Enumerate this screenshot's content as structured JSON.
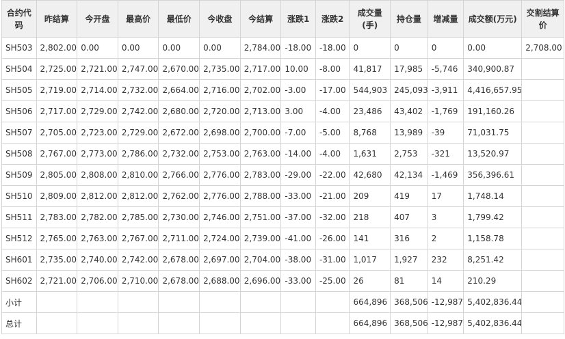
{
  "columns": [
    "合约代码",
    "昨结算",
    "今开盘",
    "最高价",
    "最低价",
    "今收盘",
    "今结算",
    "涨跌1",
    "涨跌2",
    "成交量(手)",
    "持仓量",
    "增减量",
    "成交额(万元)",
    "交割结算价"
  ],
  "rows": [
    [
      "SH503",
      "2,802.00",
      "0.00",
      "0.00",
      "0.00",
      "0.00",
      "2,784.00",
      "-18.00",
      "-18.00",
      "0",
      "0",
      "0",
      "0.00",
      "2,708.00"
    ],
    [
      "SH504",
      "2,725.00",
      "2,721.00",
      "2,747.00",
      "2,670.00",
      "2,735.00",
      "2,717.00",
      "10.00",
      "-8.00",
      "41,817",
      "17,985",
      "-5,746",
      "340,900.87",
      ""
    ],
    [
      "SH505",
      "2,719.00",
      "2,714.00",
      "2,732.00",
      "2,664.00",
      "2,716.00",
      "2,702.00",
      "-3.00",
      "-17.00",
      "544,903",
      "245,093",
      "-3,911",
      "4,416,657.95",
      ""
    ],
    [
      "SH506",
      "2,717.00",
      "2,729.00",
      "2,742.00",
      "2,680.00",
      "2,720.00",
      "2,713.00",
      "3.00",
      "-4.00",
      "23,486",
      "43,402",
      "-1,769",
      "191,160.26",
      ""
    ],
    [
      "SH507",
      "2,705.00",
      "2,723.00",
      "2,729.00",
      "2,672.00",
      "2,698.00",
      "2,700.00",
      "-7.00",
      "-5.00",
      "8,768",
      "13,989",
      "-39",
      "71,031.75",
      ""
    ],
    [
      "SH508",
      "2,767.00",
      "2,773.00",
      "2,786.00",
      "2,732.00",
      "2,753.00",
      "2,763.00",
      "-14.00",
      "-4.00",
      "1,631",
      "2,753",
      "-321",
      "13,520.97",
      ""
    ],
    [
      "SH509",
      "2,805.00",
      "2,808.00",
      "2,810.00",
      "2,766.00",
      "2,776.00",
      "2,783.00",
      "-29.00",
      "-22.00",
      "42,680",
      "42,134",
      "-1,469",
      "356,396.61",
      ""
    ],
    [
      "SH510",
      "2,809.00",
      "2,812.00",
      "2,812.00",
      "2,762.00",
      "2,776.00",
      "2,788.00",
      "-33.00",
      "-21.00",
      "209",
      "419",
      "17",
      "1,748.14",
      ""
    ],
    [
      "SH511",
      "2,783.00",
      "2,782.00",
      "2,785.00",
      "2,730.00",
      "2,746.00",
      "2,751.00",
      "-37.00",
      "-32.00",
      "218",
      "407",
      "3",
      "1,799.42",
      ""
    ],
    [
      "SH512",
      "2,765.00",
      "2,763.00",
      "2,767.00",
      "2,711.00",
      "2,724.00",
      "2,739.00",
      "-41.00",
      "-26.00",
      "141",
      "316",
      "2",
      "1,158.78",
      ""
    ],
    [
      "SH601",
      "2,735.00",
      "2,740.00",
      "2,742.00",
      "2,678.00",
      "2,697.00",
      "2,704.00",
      "-38.00",
      "-31.00",
      "1,017",
      "1,927",
      "232",
      "8,251.42",
      ""
    ],
    [
      "SH602",
      "2,721.00",
      "2,706.00",
      "2,710.00",
      "2,678.00",
      "2,688.00",
      "2,696.00",
      "-33.00",
      "-25.00",
      "26",
      "81",
      "14",
      "210.29",
      ""
    ],
    [
      "小计",
      "",
      "",
      "",
      "",
      "",
      "",
      "",
      "",
      "664,896",
      "368,506",
      "-12,987",
      "5,402,836.44",
      ""
    ],
    [
      "总计",
      "",
      "",
      "",
      "",
      "",
      "",
      "",
      "",
      "664,896",
      "368,506",
      "-12,987",
      "5,402,836.44",
      ""
    ]
  ]
}
